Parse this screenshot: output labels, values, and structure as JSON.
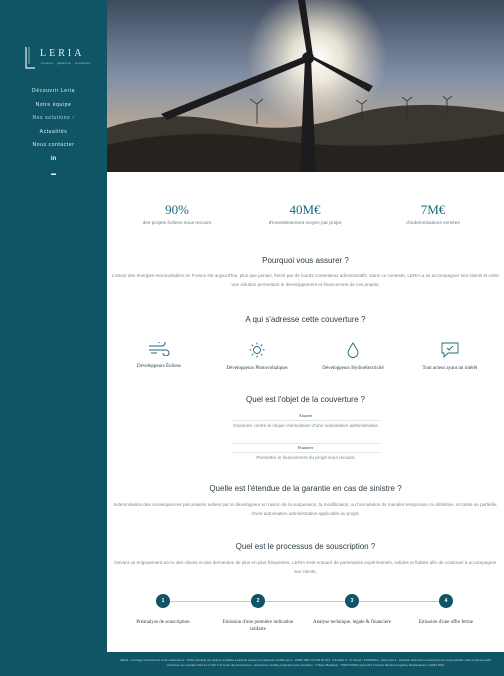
{
  "brand": {
    "name": "LERIA",
    "tagline": "conseil · garantie · expertise"
  },
  "nav": {
    "items": [
      {
        "label": "Découvrir Leria"
      },
      {
        "label": "Notre équipe"
      },
      {
        "label": "Nos solutions ›"
      },
      {
        "label": "Actualités"
      },
      {
        "label": "Nous contacter"
      }
    ],
    "social": "in",
    "lang": "▬"
  },
  "stats": [
    {
      "value": "90%",
      "label": "des projets éoliens sous recours"
    },
    {
      "value": "40M€",
      "label": "d'investissement moyen par projet"
    },
    {
      "value": "7M€",
      "label": "d'indemnisations versées"
    }
  ],
  "why": {
    "title": "Pourquoi vous assurer ?",
    "text": "L'essor des énergies renouvelables en France est aujourd'hui, plus que jamais, freiné par de lourds contentieux administratifs. Dans ce contexte, LERIA a su accompagner ses clients et créer une solution permettant le développement et financement de ces projets."
  },
  "audience": {
    "title": "A qui s'adresse cette couverture ?",
    "items": [
      {
        "label": "Développeurs Éoliens",
        "icon": "wind-icon"
      },
      {
        "label": "Développeurs Photovoltaïques",
        "icon": "sun-icon"
      },
      {
        "label": "Développeurs Hydroélectricité",
        "icon": "water-drop-icon"
      },
      {
        "label": "Tout acteur ayant un intérêt",
        "icon": "message-check-icon"
      }
    ]
  },
  "object": {
    "title": "Quel est l'objet de la couverture ?",
    "blocks": [
      {
        "heading": "Assurer",
        "text": "S'assurer contre le risque d'annulation d'une autorisation administrative."
      },
      {
        "heading": "Financer",
        "text": "Permettre le financement du projet sous recours."
      }
    ]
  },
  "scope": {
    "title": "Quelle est l'étendue de la garantie en cas de sinistre ?",
    "text": "Indemnisation des conséquences pécuniaires subies par le développeur en raison de la suspension, la modification, ou l'annulation de manière temporaire ou définitive, et totale ou partielle, d'une autorisation administrative applicable au projet."
  },
  "process": {
    "title": "Quel est le processus de souscription ?",
    "text": "Devant un engouement accru des clients et des demandes de plus en plus fréquentes, LERIA s'est entouré de partenaires expérimentés, solides et fiables afin de continuer à accompagner ses clients.",
    "steps": [
      {
        "number": "1",
        "label": "Préanalyse de souscription"
      },
      {
        "number": "2",
        "label": "Emission d'une première indication tarifaire"
      },
      {
        "number": "3",
        "label": "Analyse technique, légale & financière"
      },
      {
        "number": "4",
        "label": "Emission d'une offre ferme"
      }
    ]
  },
  "footer": {
    "text": "LERIA - Courtage d'assurances et de réassurance - SASU (Société par actions simplifiée à associé unique) au capital de 10 000 euros - SIRET 890 774 452 00 012 - 9 E Paris 8 - 17 Grand - 12/08/2019 - www.orias.fr - Garantie financière et assurance de responsabilité civile professionnelle conformes aux articles L512-6 et L512-7 du Code des Assurances - Autorité de contrôle prudentiel et de résolution : 4 Place Budapest - 75436 PARIS cedex 09 | Contact | Mentions légales | Réclamations | LERIA 2021",
    "colors": {
      "primary": "#0f5566",
      "background": "#ffffff"
    }
  }
}
